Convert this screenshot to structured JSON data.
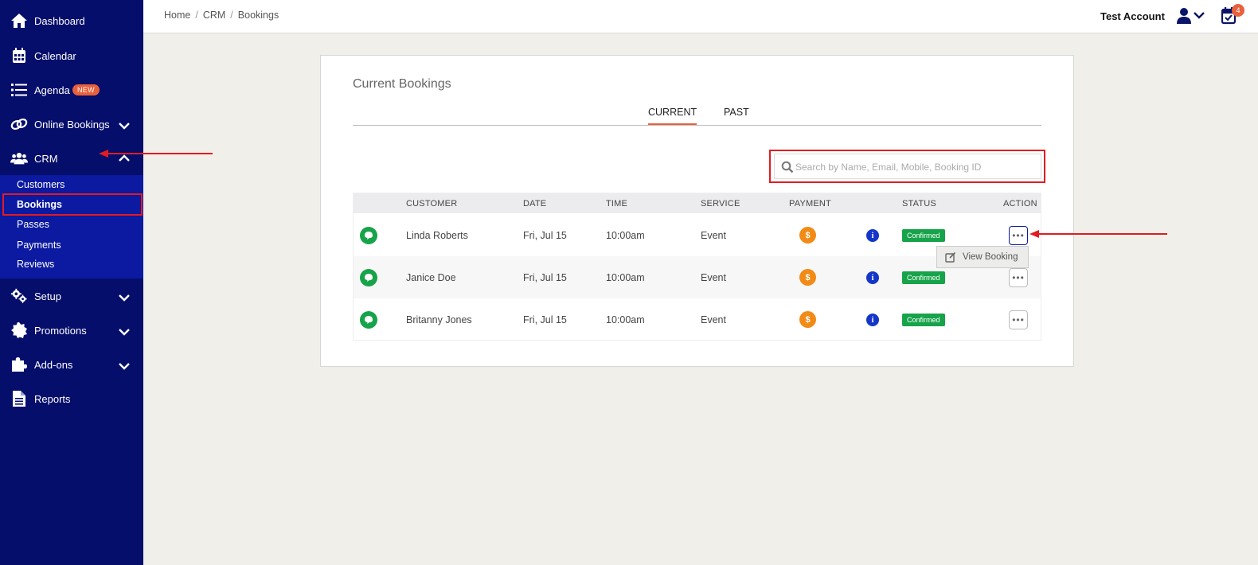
{
  "sidebar": {
    "items": [
      {
        "label": "Dashboard",
        "icon": "home-icon"
      },
      {
        "label": "Calendar",
        "icon": "calendar-icon"
      },
      {
        "label": "Agenda",
        "icon": "list-icon",
        "badge": "NEW"
      },
      {
        "label": "Online Bookings",
        "icon": "link-icon"
      },
      {
        "label": "CRM",
        "icon": "users-icon"
      },
      {
        "label": "Setup",
        "icon": "gears-icon"
      },
      {
        "label": "Promotions",
        "icon": "badge-icon"
      },
      {
        "label": "Add-ons",
        "icon": "puzzle-icon"
      },
      {
        "label": "Reports",
        "icon": "file-icon"
      }
    ],
    "crm_submenu": [
      "Customers",
      "Bookings",
      "Passes",
      "Payments",
      "Reviews"
    ]
  },
  "topbar": {
    "breadcrumbs": [
      "Home",
      "CRM",
      "Bookings"
    ],
    "separator": "/",
    "account_name": "Test Account",
    "notification_count": "4"
  },
  "main": {
    "title": "Current Bookings",
    "tabs": [
      "CURRENT",
      "PAST"
    ],
    "search_placeholder": "Search by Name, Email, Mobile, Booking ID",
    "columns": [
      "CUSTOMER",
      "DATE",
      "TIME",
      "SERVICE",
      "PAYMENT",
      "STATUS",
      "ACTION"
    ],
    "rows": [
      {
        "customer": "Linda Roberts",
        "date": "Fri, Jul 15",
        "time": "10:00am",
        "service": "Event",
        "payment_symbol": "$",
        "status": "Confirmed"
      },
      {
        "customer": "Janice Doe",
        "date": "Fri, Jul 15",
        "time": "10:00am",
        "service": "Event",
        "payment_symbol": "$",
        "status": "Confirmed"
      },
      {
        "customer": "Britanny Jones",
        "date": "Fri, Jul 15",
        "time": "10:00am",
        "service": "Event",
        "payment_symbol": "$",
        "status": "Confirmed"
      }
    ],
    "action_menu": {
      "view_booking": "View Booking"
    },
    "info_symbol": "i",
    "action_dots": "•••"
  },
  "colors": {
    "sidebar_bg": "#050e6b",
    "submenu_bg": "#0b1aa0",
    "accent": "#e8603c",
    "status_green": "#16a34a",
    "payment_orange": "#f28a16",
    "info_blue": "#1436c8",
    "annotation_red": "#e21b22"
  }
}
